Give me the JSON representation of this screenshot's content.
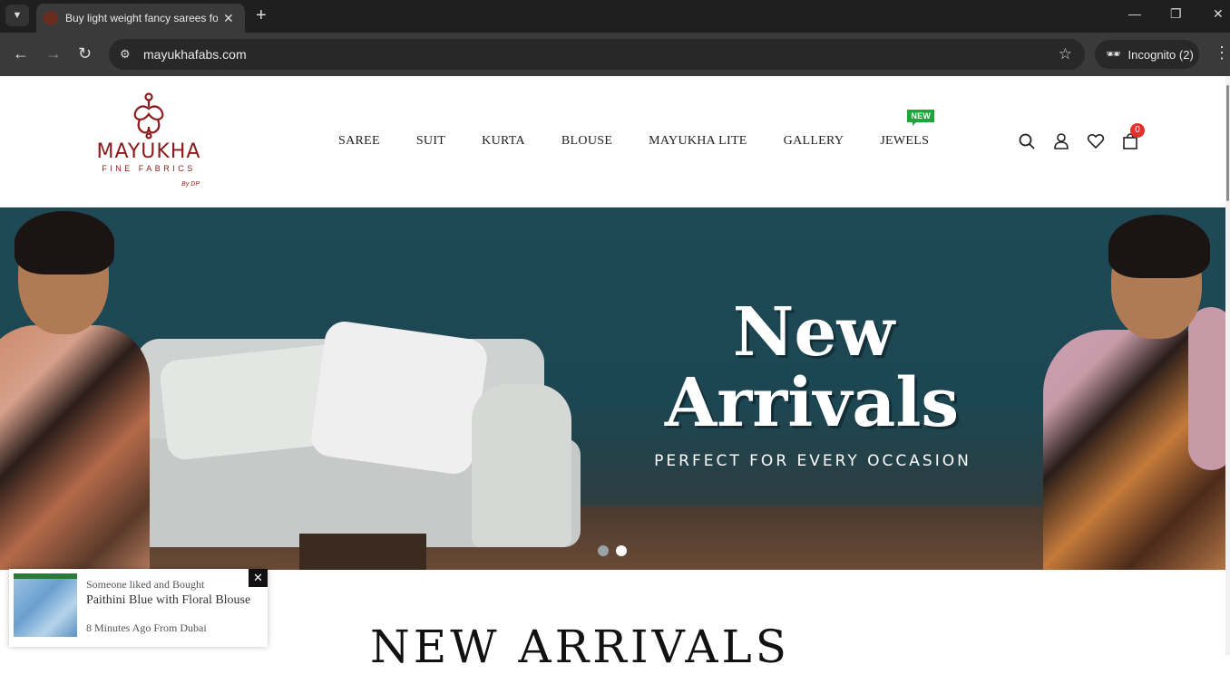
{
  "browser": {
    "tab_title": "Buy light weight fancy sarees fo",
    "url": "mayukhafabs.com",
    "profile_label": "Incognito (2)"
  },
  "site": {
    "logo_name": "MAYUKHA",
    "logo_subtitle": "FINE FABRICS",
    "logo_byline": "By DP",
    "brand_color": "#8b1a1a",
    "nav": [
      {
        "label": "SAREE"
      },
      {
        "label": "SUIT"
      },
      {
        "label": "KURTA"
      },
      {
        "label": "BLOUSE"
      },
      {
        "label": "MAYUKHA LITE"
      },
      {
        "label": "GALLERY"
      },
      {
        "label": "JEWELS",
        "badge": "NEW"
      }
    ],
    "icons": [
      "search-icon",
      "user-icon",
      "heart-icon",
      "cart-icon"
    ],
    "cart_count": "0"
  },
  "hero": {
    "title_line1": "New",
    "title_line2": "Arrivals",
    "subtitle": "PERFECT FOR EVERY OCCASION",
    "slides": 2,
    "active_slide": 2
  },
  "section": {
    "title": "NEW ARRIVALS"
  },
  "popup": {
    "line1": "Someone liked and Bought",
    "product": "Paithini Blue with Floral Blouse",
    "line3": "8 Minutes Ago From Dubai",
    "close": "✕"
  }
}
